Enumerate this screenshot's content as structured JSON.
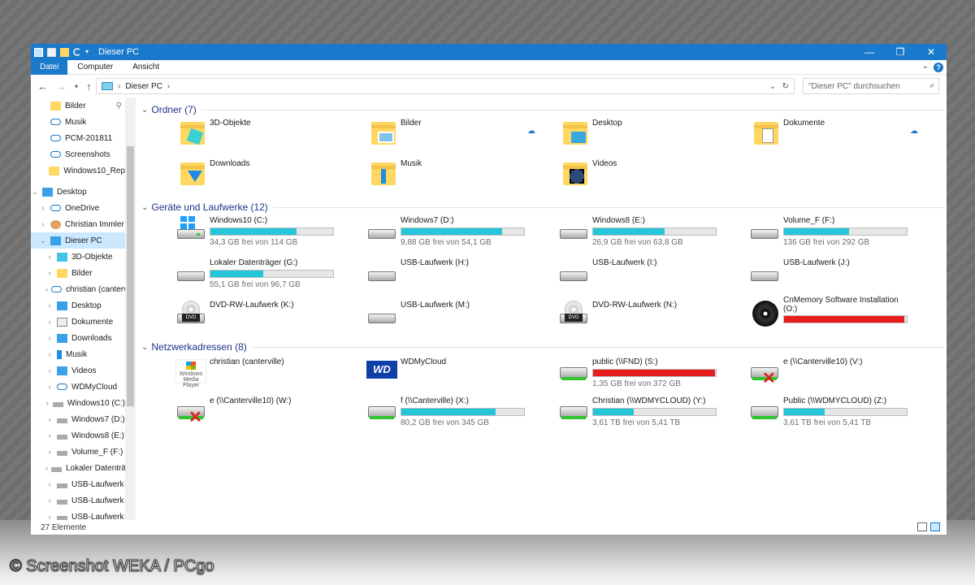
{
  "window": {
    "title": "Dieser PC",
    "controls": {
      "minimize": "—",
      "maximize": "❐",
      "close": "✕"
    }
  },
  "ribbon": {
    "tabs": [
      "Datei",
      "Computer",
      "Ansicht"
    ],
    "help": "?"
  },
  "address": {
    "path": "Dieser PC",
    "separator": "›",
    "search_placeholder": "\"Dieser PC\" durchsuchen"
  },
  "sidebar": {
    "items": [
      {
        "label": "Bilder",
        "icon": "pictures-folder-icon",
        "pinned": true
      },
      {
        "label": "Musik",
        "icon": "onedrive-folder-icon"
      },
      {
        "label": "PCM-201811",
        "icon": "onedrive-folder-icon"
      },
      {
        "label": "Screenshots",
        "icon": "onedrive-folder-icon"
      },
      {
        "label": "Windows10_Rep",
        "icon": "folder-icon"
      },
      {
        "label": "Desktop",
        "icon": "desktop-icon",
        "expanded": true
      },
      {
        "label": "OneDrive",
        "icon": "onedrive-icon"
      },
      {
        "label": "Christian Immler",
        "icon": "user-icon"
      },
      {
        "label": "Dieser PC",
        "icon": "this-pc-icon",
        "selected": true,
        "expanded": true
      },
      {
        "label": "3D-Objekte",
        "icon": "3d-objects-icon"
      },
      {
        "label": "Bilder",
        "icon": "pictures-icon"
      },
      {
        "label": "christian (canterville)",
        "icon": "network-location-icon"
      },
      {
        "label": "Desktop",
        "icon": "desktop-icon"
      },
      {
        "label": "Dokumente",
        "icon": "documents-icon"
      },
      {
        "label": "Downloads",
        "icon": "downloads-icon"
      },
      {
        "label": "Musik",
        "icon": "music-icon"
      },
      {
        "label": "Videos",
        "icon": "videos-icon"
      },
      {
        "label": "WDMyCloud",
        "icon": "network-location-icon"
      },
      {
        "label": "Windows10 (C:)",
        "icon": "windows-drive-icon"
      },
      {
        "label": "Windows7 (D:)",
        "icon": "drive-icon"
      },
      {
        "label": "Windows8 (E:)",
        "icon": "drive-icon"
      },
      {
        "label": "Volume_F (F:)",
        "icon": "drive-icon"
      },
      {
        "label": "Lokaler Datenträger (G:)",
        "icon": "drive-icon"
      },
      {
        "label": "USB-Laufwerk",
        "icon": "drive-icon"
      },
      {
        "label": "USB-Laufwerk",
        "icon": "drive-icon"
      },
      {
        "label": "USB-Laufwerk",
        "icon": "drive-icon"
      }
    ]
  },
  "sections": {
    "folders": {
      "label": "Ordner (7)"
    },
    "drives": {
      "label": "Geräte und Laufwerke (12)"
    },
    "network": {
      "label": "Netzwerkadressen (8)"
    }
  },
  "folders": [
    {
      "name": "3D-Objekte",
      "icon": "3d-objects-folder-icon"
    },
    {
      "name": "Bilder",
      "icon": "pictures-folder-icon",
      "cloud": true
    },
    {
      "name": "Desktop",
      "icon": "desktop-folder-icon"
    },
    {
      "name": "Dokumente",
      "icon": "documents-folder-icon",
      "cloud": true
    },
    {
      "name": "Downloads",
      "icon": "downloads-folder-icon"
    },
    {
      "name": "Musik",
      "icon": "music-folder-icon"
    },
    {
      "name": "Videos",
      "icon": "videos-folder-icon"
    }
  ],
  "drives": [
    {
      "name": "Windows10 (C:)",
      "free": "34,3 GB frei von 114 GB",
      "used_fraction": 0.7,
      "icon": "windows-drive-icon"
    },
    {
      "name": "Windows7 (D:)",
      "free": "9,88 GB frei von 54,1 GB",
      "used_fraction": 0.82,
      "icon": "drive-icon"
    },
    {
      "name": "Windows8 (E:)",
      "free": "26,9 GB frei von 63,8 GB",
      "used_fraction": 0.58,
      "icon": "drive-icon"
    },
    {
      "name": "Volume_F (F:)",
      "free": "136 GB frei von 292 GB",
      "used_fraction": 0.53,
      "icon": "drive-icon"
    },
    {
      "name": "Lokaler Datenträger (G:)",
      "free": "55,1 GB frei von 96,7 GB",
      "used_fraction": 0.43,
      "icon": "drive-icon"
    },
    {
      "name": "USB-Laufwerk (H:)",
      "icon": "usb-drive-icon"
    },
    {
      "name": "USB-Laufwerk (I:)",
      "icon": "usb-drive-icon"
    },
    {
      "name": "USB-Laufwerk (J:)",
      "icon": "usb-drive-icon"
    },
    {
      "name": "DVD-RW-Laufwerk (K:)",
      "icon": "dvd-drive-icon",
      "badge": "DVD"
    },
    {
      "name": "USB-Laufwerk (M:)",
      "icon": "usb-drive-icon"
    },
    {
      "name": "DVD-RW-Laufwerk (N:)",
      "icon": "dvd-drive-icon",
      "badge": "DVD"
    },
    {
      "name": "CnMemory Software Installation (O:)",
      "used_fraction": 0.98,
      "full": true,
      "icon": "cd-icon"
    }
  ],
  "network": [
    {
      "name": "christian (canterville)",
      "icon": "media-player-icon",
      "logo_text": "Windows Media Player"
    },
    {
      "name": "WDMyCloud",
      "icon": "wd-logo-icon",
      "logo_text": "WD"
    },
    {
      "name": "public (\\\\FND) (S:)",
      "free": "1,35 GB frei von 372 GB",
      "used_fraction": 0.996,
      "full": true,
      "icon": "network-drive-icon"
    },
    {
      "name": "e (\\\\Canterville10) (V:)",
      "icon": "network-drive-disconnected-icon"
    },
    {
      "name": "e (\\\\Canterville10) (W:)",
      "icon": "network-drive-disconnected-icon"
    },
    {
      "name": "f (\\\\Canterville) (X:)",
      "free": "80,2 GB frei von 345 GB",
      "used_fraction": 0.77,
      "icon": "network-drive-icon"
    },
    {
      "name": "Christian (\\\\WDMYCLOUD) (Y:)",
      "free": "3,61 TB frei von 5,41 TB",
      "used_fraction": 0.33,
      "icon": "network-drive-icon"
    },
    {
      "name": "Public (\\\\WDMYCLOUD) (Z:)",
      "free": "3,61 TB frei von 5,41 TB",
      "used_fraction": 0.33,
      "icon": "network-drive-icon"
    }
  ],
  "status": {
    "count": "27 Elemente"
  },
  "credit": "© Screenshot WEKA / PCgo",
  "colors": {
    "accent": "#1979ca",
    "bar": "#26c6da",
    "bar_full": "#e81c1c",
    "selection": "#cce8ff",
    "section_text": "#1e3287"
  }
}
